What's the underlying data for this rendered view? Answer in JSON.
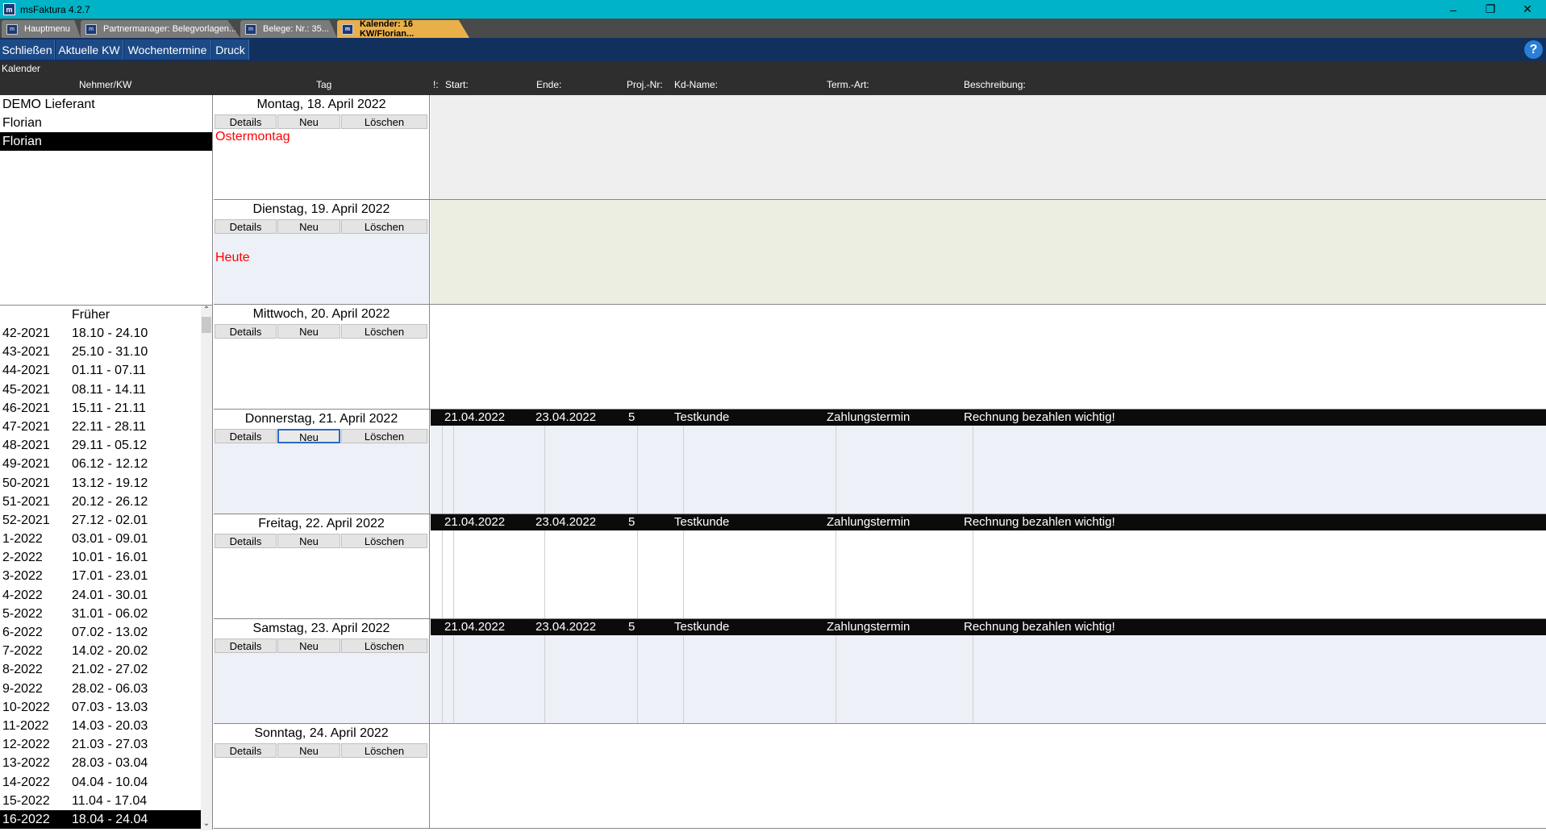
{
  "window": {
    "title": "msFaktura 4.2.7"
  },
  "tabs": [
    {
      "label": "Hauptmenu"
    },
    {
      "label": "Partnermanager: Belegvorlagen..."
    },
    {
      "label": "Belege: Nr.: 35..."
    },
    {
      "label": "Kalender: 16 KW/Florian..."
    }
  ],
  "toolbar": {
    "close": "Schließen",
    "current_week": "Aktuelle KW",
    "week_appointments": "Wochentermine",
    "print": "Druck",
    "help": "?"
  },
  "subheader": {
    "title": "Kalender",
    "col_person": "Nehmer/KW",
    "col_day": "Tag",
    "col_flag": "!:",
    "col_start": "Start:",
    "col_end": "Ende:",
    "col_proj": "Proj.-Nr:",
    "col_customer": "Kd-Name:",
    "col_type": "Term.-Art:",
    "col_desc": "Beschreibung:"
  },
  "persons": [
    "DEMO Lieferant",
    "Florian",
    "Florian"
  ],
  "weeks": {
    "earlier": "Früher",
    "rows": [
      [
        "42-2021",
        "18.10 - 24.10"
      ],
      [
        "43-2021",
        "25.10 - 31.10"
      ],
      [
        "44-2021",
        "01.11 - 07.11"
      ],
      [
        "45-2021",
        "08.11 - 14.11"
      ],
      [
        "46-2021",
        "15.11 - 21.11"
      ],
      [
        "47-2021",
        "22.11 - 28.11"
      ],
      [
        "48-2021",
        "29.11 - 05.12"
      ],
      [
        "49-2021",
        "06.12 - 12.12"
      ],
      [
        "50-2021",
        "13.12 - 19.12"
      ],
      [
        "51-2021",
        "20.12 - 26.12"
      ],
      [
        "52-2021",
        "27.12 - 02.01"
      ],
      [
        "1-2022",
        "03.01 - 09.01"
      ],
      [
        "2-2022",
        "10.01 - 16.01"
      ],
      [
        "3-2022",
        "17.01 - 23.01"
      ],
      [
        "4-2022",
        "24.01 - 30.01"
      ],
      [
        "5-2022",
        "31.01 - 06.02"
      ],
      [
        "6-2022",
        "07.02 - 13.02"
      ],
      [
        "7-2022",
        "14.02 - 20.02"
      ],
      [
        "8-2022",
        "21.02 - 27.02"
      ],
      [
        "9-2022",
        "28.02 - 06.03"
      ],
      [
        "10-2022",
        "07.03 - 13.03"
      ],
      [
        "11-2022",
        "14.03 - 20.03"
      ],
      [
        "12-2022",
        "21.03 - 27.03"
      ],
      [
        "13-2022",
        "28.03 - 03.04"
      ],
      [
        "14-2022",
        "04.04 - 10.04"
      ],
      [
        "15-2022",
        "11.04 - 17.04"
      ],
      [
        "16-2022",
        "18.04 - 24.04"
      ]
    ]
  },
  "day_buttons": {
    "details": "Details",
    "new": "Neu",
    "delete": "Löschen"
  },
  "days": [
    {
      "title": "Montag, 18. April 2022",
      "note": "Ostermontag",
      "left_bg": "#ffffff",
      "right_bg": "#efefef",
      "event": null
    },
    {
      "title": "Dienstag, 19. April 2022",
      "note": "Heute",
      "left_bg": "#edf0f6",
      "right_bg": "#ebeee0",
      "event": null
    },
    {
      "title": "Mittwoch, 20. April 2022",
      "note": "",
      "left_bg": "#ffffff",
      "right_bg": "#ffffff",
      "event": null
    },
    {
      "title": "Donnerstag, 21. April 2022",
      "note": "",
      "left_bg": "#edf0f6",
      "right_bg": "#edf0f6",
      "event": {
        "start": "21.04.2022",
        "end": "23.04.2022",
        "proj": "5",
        "customer": "Testkunde",
        "type": "Zahlungstermin",
        "desc": "Rechnung bezahlen wichtig!"
      }
    },
    {
      "title": "Freitag, 22. April 2022",
      "note": "",
      "left_bg": "#ffffff",
      "right_bg": "#ffffff",
      "event": {
        "start": "21.04.2022",
        "end": "23.04.2022",
        "proj": "5",
        "customer": "Testkunde",
        "type": "Zahlungstermin",
        "desc": "Rechnung bezahlen wichtig!"
      }
    },
    {
      "title": "Samstag, 23. April 2022",
      "note": "",
      "left_bg": "#edf0f6",
      "right_bg": "#edf0f6",
      "event": {
        "start": "21.04.2022",
        "end": "23.04.2022",
        "proj": "5",
        "customer": "Testkunde",
        "type": "Zahlungstermin",
        "desc": "Rechnung bezahlen wichtig!"
      }
    },
    {
      "title": "Sonntag, 24. April 2022",
      "note": "",
      "left_bg": "#ffffff",
      "right_bg": "#ffffff",
      "event": null
    }
  ]
}
